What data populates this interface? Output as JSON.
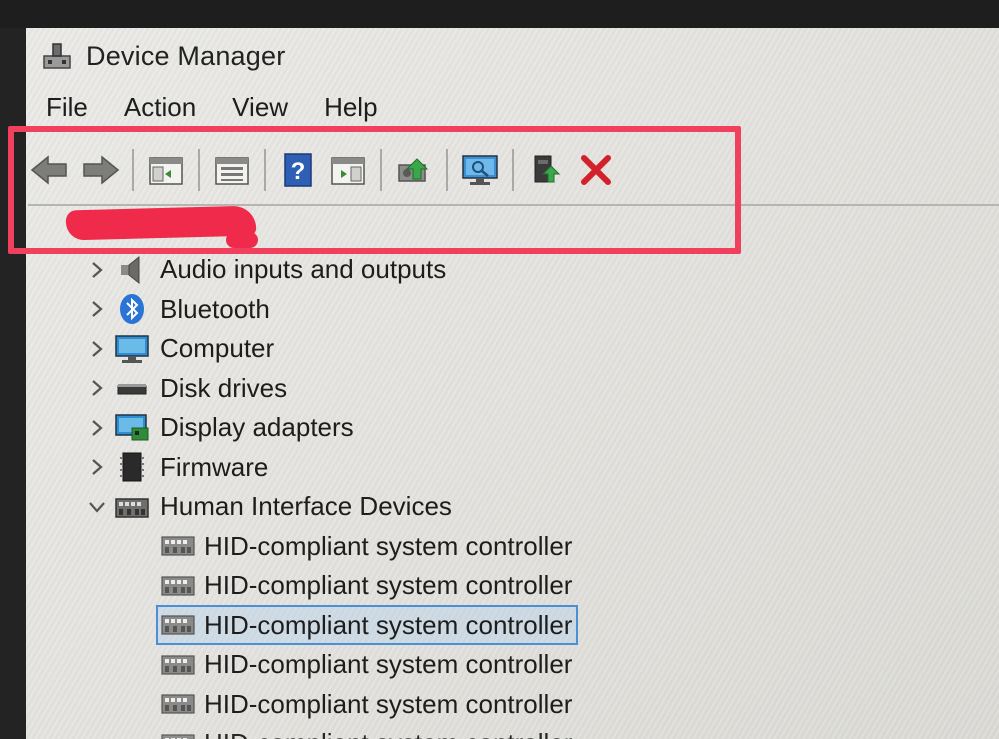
{
  "window": {
    "title": "Device Manager"
  },
  "menu": {
    "items": [
      "File",
      "Action",
      "View",
      "Help"
    ]
  },
  "toolbar": {
    "buttons": [
      {
        "name": "back-button",
        "icon": "arrow-left-icon"
      },
      {
        "name": "forward-button",
        "icon": "arrow-right-icon"
      },
      {
        "name": "show-hide-console-tree-button",
        "icon": "console-tree-icon"
      },
      {
        "name": "properties-button",
        "icon": "properties-icon"
      },
      {
        "name": "help-button",
        "icon": "help-icon"
      },
      {
        "name": "show-action-pane-button",
        "icon": "action-pane-icon"
      },
      {
        "name": "update-driver-button",
        "icon": "update-driver-icon"
      },
      {
        "name": "scan-hardware-changes-button",
        "icon": "scan-hardware-icon"
      },
      {
        "name": "add-legacy-hardware-button",
        "icon": "add-hardware-icon"
      },
      {
        "name": "uninstall-device-button",
        "icon": "uninstall-x-icon"
      }
    ],
    "annotation_color": "#f0405e"
  },
  "tree": {
    "categories": [
      {
        "label": "Audio inputs and outputs",
        "icon": "speaker-icon",
        "expanded": false
      },
      {
        "label": "Bluetooth",
        "icon": "bluetooth-icon",
        "expanded": false
      },
      {
        "label": "Computer",
        "icon": "monitor-icon",
        "expanded": false
      },
      {
        "label": "Disk drives",
        "icon": "disk-drive-icon",
        "expanded": false
      },
      {
        "label": "Display adapters",
        "icon": "display-adapter-icon",
        "expanded": false
      },
      {
        "label": "Firmware",
        "icon": "firmware-chip-icon",
        "expanded": false
      },
      {
        "label": "Human Interface Devices",
        "icon": "hid-icon",
        "expanded": true
      }
    ],
    "hid_children": [
      {
        "label": "HID-compliant system controller",
        "selected": false
      },
      {
        "label": "HID-compliant system controller",
        "selected": false
      },
      {
        "label": "HID-compliant system controller",
        "selected": true
      },
      {
        "label": "HID-compliant system controller",
        "selected": false
      },
      {
        "label": "HID-compliant system controller",
        "selected": false
      },
      {
        "label": "HID-compliant system controller",
        "selected": false
      }
    ]
  }
}
